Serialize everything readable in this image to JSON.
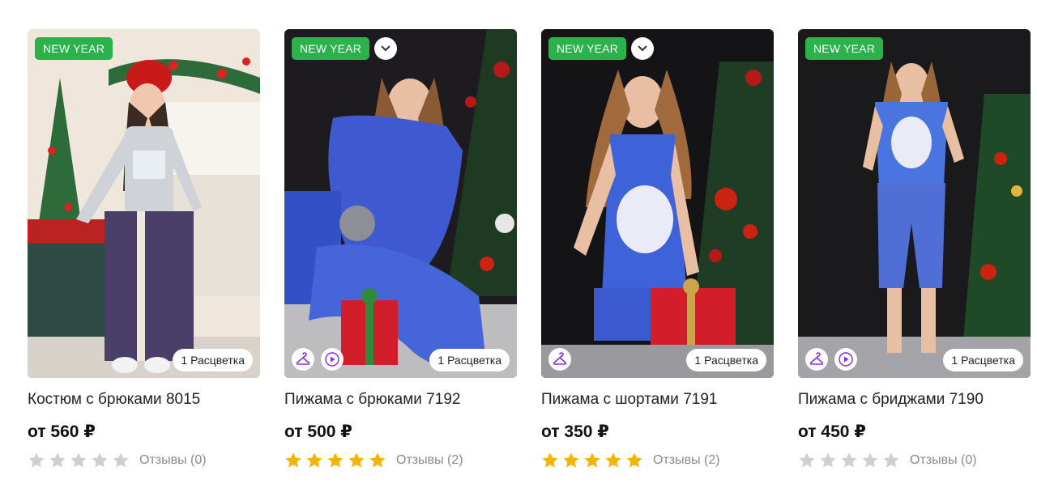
{
  "colors": {
    "badge": "#2bb24c",
    "star_filled": "#f6b300",
    "star_empty": "#cfcfcf",
    "accent_icon": "#8a2be2"
  },
  "products": [
    {
      "badge": "NEW YEAR",
      "has_chevron": false,
      "color_label": "1 Расцветка",
      "buttons": [],
      "title": "Костюм с брюками 8015",
      "price": "от 560 ₽",
      "rating": 0,
      "reviews": "Отзывы (0)"
    },
    {
      "badge": "NEW YEAR",
      "has_chevron": true,
      "color_label": "1 Расцветка",
      "buttons": [
        "hanger-icon",
        "play-icon"
      ],
      "title": "Пижама с брюками 7192",
      "price": "от 500 ₽",
      "rating": 5,
      "reviews": "Отзывы (2)"
    },
    {
      "badge": "NEW YEAR",
      "has_chevron": true,
      "color_label": "1 Расцветка",
      "buttons": [
        "hanger-icon"
      ],
      "title": "Пижама с шортами 7191",
      "price": "от 350 ₽",
      "rating": 5,
      "reviews": "Отзывы (2)"
    },
    {
      "badge": "NEW YEAR",
      "has_chevron": false,
      "color_label": "1 Расцветка",
      "buttons": [
        "hanger-icon",
        "play-icon"
      ],
      "title": "Пижама с бриджами 7190",
      "price": "от 450 ₽",
      "rating": 0,
      "reviews": "Отзывы (0)"
    }
  ]
}
